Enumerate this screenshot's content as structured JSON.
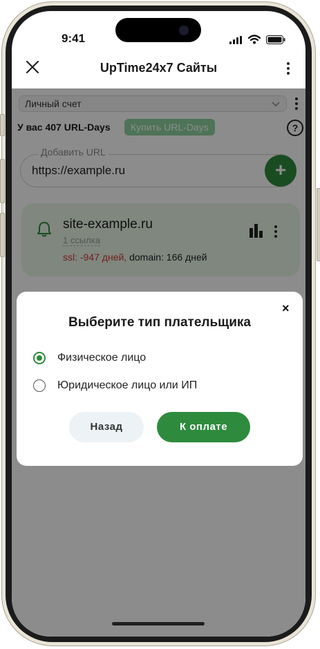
{
  "status_bar": {
    "time": "9:41"
  },
  "top_bar": {
    "title": "UpTime24x7 Сайты"
  },
  "account": {
    "selected": "Личный счет",
    "balance": "У вас 407 URL-Days",
    "buy_label": "Купить URL-Days",
    "help": "?"
  },
  "add_url": {
    "legend": "Добавить URL",
    "value": "https://example.ru",
    "add_symbol": "+"
  },
  "site": {
    "name": "site-example.ru",
    "links": "1 ссылка",
    "ssl": "ssl: -947 дней,",
    "domain": "domain: 166 дней"
  },
  "modal": {
    "close": "×",
    "title": "Выберите тип плательщика",
    "options": [
      {
        "label": "Физическое лицо",
        "selected": true
      },
      {
        "label": "Юридическое лицо или ИП",
        "selected": false
      }
    ],
    "back_label": "Назад",
    "pay_label": "К оплате"
  },
  "colors": {
    "accent": "#2e8b3d",
    "accent_light": "#8ed19e",
    "danger": "#d23a3a",
    "card_bg": "#e7f6e8"
  }
}
